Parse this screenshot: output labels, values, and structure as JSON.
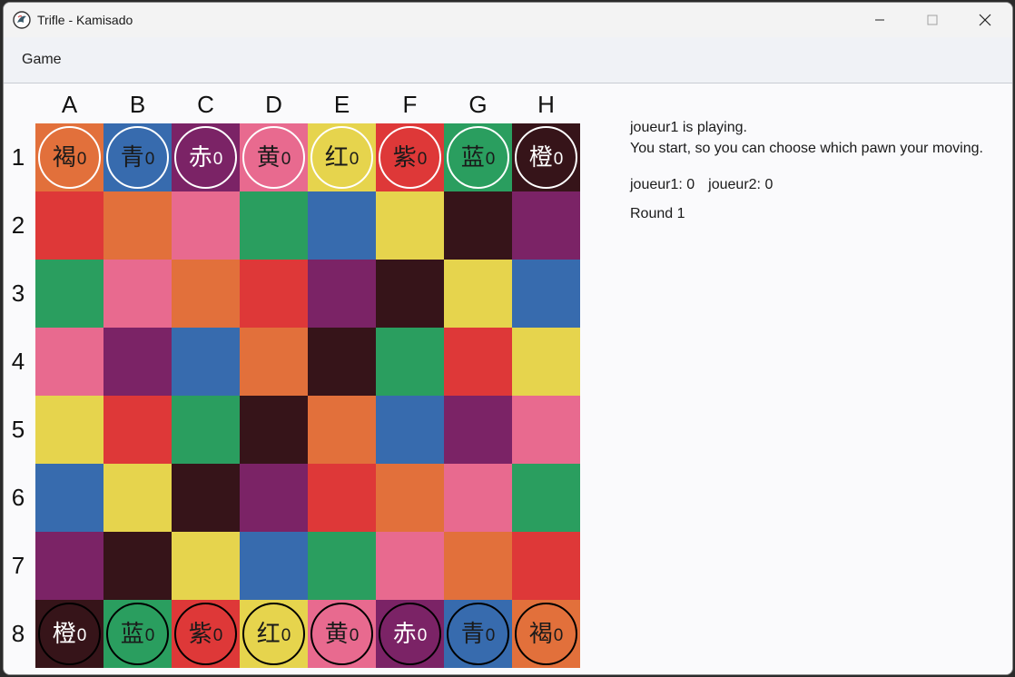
{
  "window": {
    "title": "Trifle - Kamisado"
  },
  "menu": {
    "game_label": "Game"
  },
  "columns": [
    "A",
    "B",
    "C",
    "D",
    "E",
    "F",
    "G",
    "H"
  ],
  "rows": [
    "1",
    "2",
    "3",
    "4",
    "5",
    "6",
    "7",
    "8"
  ],
  "colors": {
    "orange": "#e2703b",
    "blue": "#376bae",
    "purple": "#7b2366",
    "pink": "#e86a8f",
    "yellow": "#e6d44d",
    "red": "#de3838",
    "green": "#2a9e5f",
    "brown": "#361419"
  },
  "board": [
    [
      "orange",
      "blue",
      "purple",
      "pink",
      "yellow",
      "red",
      "green",
      "brown"
    ],
    [
      "red",
      "orange",
      "pink",
      "green",
      "blue",
      "yellow",
      "brown",
      "purple"
    ],
    [
      "green",
      "pink",
      "orange",
      "red",
      "purple",
      "brown",
      "yellow",
      "blue"
    ],
    [
      "pink",
      "purple",
      "blue",
      "orange",
      "brown",
      "green",
      "red",
      "yellow"
    ],
    [
      "yellow",
      "red",
      "green",
      "brown",
      "orange",
      "blue",
      "purple",
      "pink"
    ],
    [
      "blue",
      "yellow",
      "brown",
      "purple",
      "red",
      "orange",
      "pink",
      "green"
    ],
    [
      "purple",
      "brown",
      "yellow",
      "blue",
      "green",
      "pink",
      "orange",
      "red"
    ],
    [
      "brown",
      "green",
      "red",
      "yellow",
      "pink",
      "purple",
      "blue",
      "orange"
    ]
  ],
  "pawns": [
    {
      "row": 0,
      "col": 0,
      "player": "joueur2",
      "color": "orange",
      "glyph": "褐",
      "count": "0",
      "text_color": "#1a1a1a"
    },
    {
      "row": 0,
      "col": 1,
      "player": "joueur2",
      "color": "blue",
      "glyph": "青",
      "count": "0",
      "text_color": "#1a1a1a"
    },
    {
      "row": 0,
      "col": 2,
      "player": "joueur2",
      "color": "purple",
      "glyph": "赤",
      "count": "0",
      "text_color": "#ffffff"
    },
    {
      "row": 0,
      "col": 3,
      "player": "joueur2",
      "color": "pink",
      "glyph": "黄",
      "count": "0",
      "text_color": "#1a1a1a"
    },
    {
      "row": 0,
      "col": 4,
      "player": "joueur2",
      "color": "yellow",
      "glyph": "红",
      "count": "0",
      "text_color": "#1a1a1a"
    },
    {
      "row": 0,
      "col": 5,
      "player": "joueur2",
      "color": "red",
      "glyph": "紫",
      "count": "0",
      "text_color": "#1a1a1a"
    },
    {
      "row": 0,
      "col": 6,
      "player": "joueur2",
      "color": "green",
      "glyph": "蓝",
      "count": "0",
      "text_color": "#1a1a1a"
    },
    {
      "row": 0,
      "col": 7,
      "player": "joueur2",
      "color": "brown",
      "glyph": "橙",
      "count": "0",
      "text_color": "#ffffff"
    },
    {
      "row": 7,
      "col": 0,
      "player": "joueur1",
      "color": "brown",
      "glyph": "橙",
      "count": "0",
      "text_color": "#ffffff"
    },
    {
      "row": 7,
      "col": 1,
      "player": "joueur1",
      "color": "green",
      "glyph": "蓝",
      "count": "0",
      "text_color": "#1a1a1a"
    },
    {
      "row": 7,
      "col": 2,
      "player": "joueur1",
      "color": "red",
      "glyph": "紫",
      "count": "0",
      "text_color": "#1a1a1a"
    },
    {
      "row": 7,
      "col": 3,
      "player": "joueur1",
      "color": "yellow",
      "glyph": "红",
      "count": "0",
      "text_color": "#1a1a1a"
    },
    {
      "row": 7,
      "col": 4,
      "player": "joueur1",
      "color": "pink",
      "glyph": "黄",
      "count": "0",
      "text_color": "#1a1a1a"
    },
    {
      "row": 7,
      "col": 5,
      "player": "joueur1",
      "color": "purple",
      "glyph": "赤",
      "count": "0",
      "text_color": "#ffffff"
    },
    {
      "row": 7,
      "col": 6,
      "player": "joueur1",
      "color": "blue",
      "glyph": "青",
      "count": "0",
      "text_color": "#1a1a1a"
    },
    {
      "row": 7,
      "col": 7,
      "player": "joueur1",
      "color": "orange",
      "glyph": "褐",
      "count": "0",
      "text_color": "#1a1a1a"
    }
  ],
  "player_colors": {
    "joueur1": "#000000",
    "joueur2": "#ffffff"
  },
  "status": {
    "turn_text": "joueur1 is playing.",
    "hint_text": "You start, so you can choose which pawn your moving.",
    "score_p1": "joueur1: 0",
    "score_p2": "joueur2: 0",
    "round_text": "Round 1"
  }
}
